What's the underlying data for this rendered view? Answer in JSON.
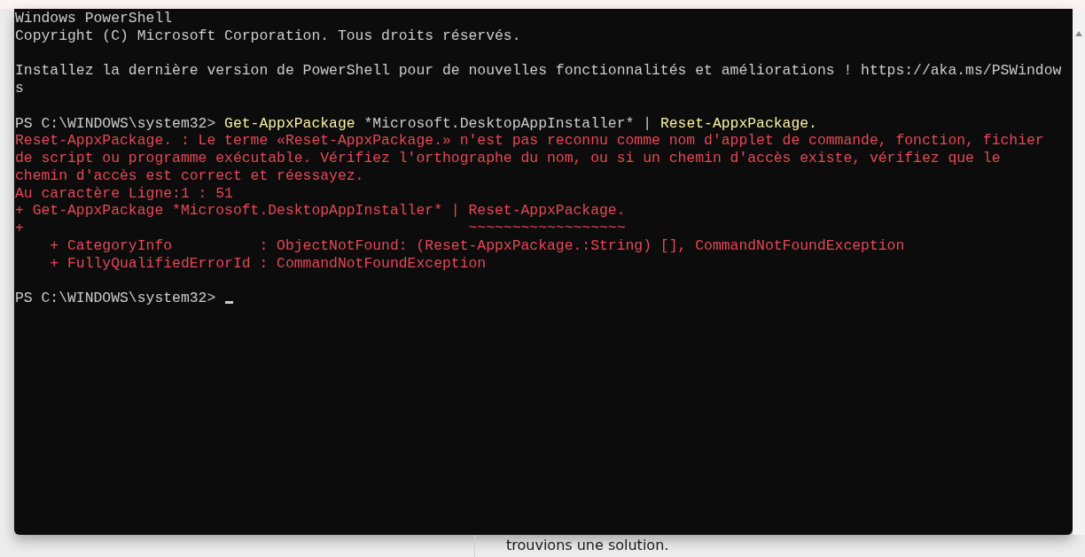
{
  "terminal": {
    "lines": [
      {
        "kind": "output",
        "text": "Windows PowerShell"
      },
      {
        "kind": "output",
        "text": "Copyright (C) Microsoft Corporation. Tous droits réservés."
      },
      {
        "kind": "blank"
      },
      {
        "kind": "output",
        "text": "Installez la dernière version de PowerShell pour de nouvelles fonctionnalités et améliorations ! https://aka.ms/PSWindow"
      },
      {
        "kind": "output",
        "text": "s"
      },
      {
        "kind": "blank"
      },
      {
        "kind": "prompt",
        "prompt": "PS C:\\WINDOWS\\system32> ",
        "segments": [
          {
            "kind": "cmdlet",
            "text": "Get-AppxPackage"
          },
          {
            "kind": "argument",
            "text": " *Microsoft.DesktopAppInstaller* | "
          },
          {
            "kind": "cmdlet",
            "text": "Reset-AppxPackage."
          }
        ]
      },
      {
        "kind": "error",
        "text": "Reset-AppxPackage. : Le terme «Reset-AppxPackage.» n'est pas reconnu comme nom d'applet de commande, fonction, fichier"
      },
      {
        "kind": "error",
        "text": "de script ou programme exécutable. Vérifiez l'orthographe du nom, ou si un chemin d'accès existe, vérifiez que le"
      },
      {
        "kind": "error",
        "text": "chemin d'accès est correct et réessayez."
      },
      {
        "kind": "error",
        "text": "Au caractère Ligne:1 : 51"
      },
      {
        "kind": "error",
        "text": "+ Get-AppxPackage *Microsoft.DesktopAppInstaller* | Reset-AppxPackage."
      },
      {
        "kind": "error",
        "text": "+                                                   ~~~~~~~~~~~~~~~~~~"
      },
      {
        "kind": "error",
        "text": "    + CategoryInfo          : ObjectNotFound: (Reset-AppxPackage.:String) [], CommandNotFoundException"
      },
      {
        "kind": "error",
        "text": "    + FullyQualifiedErrorId : CommandNotFoundException"
      },
      {
        "kind": "blank"
      },
      {
        "kind": "prompt",
        "prompt": "PS C:\\WINDOWS\\system32> ",
        "cursor": true
      }
    ]
  },
  "background": {
    "text": "trouvions une solution."
  }
}
